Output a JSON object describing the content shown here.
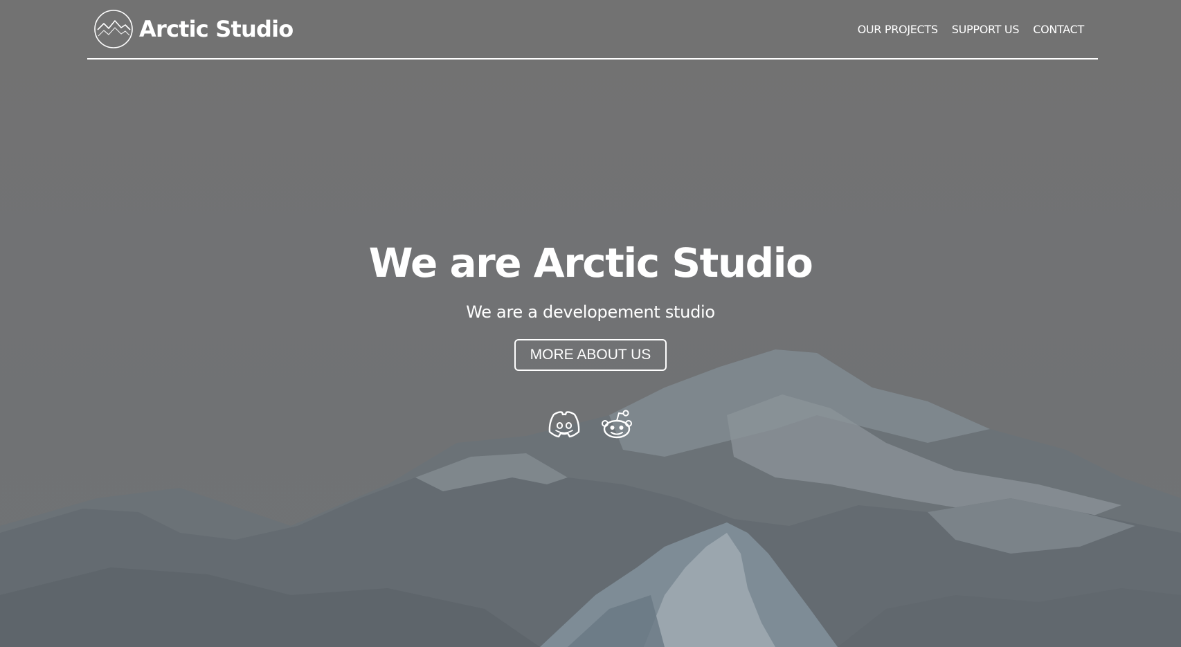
{
  "header": {
    "brand_name": "Arctic Studio",
    "logo_icon": "mountain-circle-logo",
    "nav": [
      {
        "label": "OUR PROJECTS"
      },
      {
        "label": "SUPPORT US"
      },
      {
        "label": "CONTACT"
      }
    ]
  },
  "hero": {
    "title": "We are Arctic Studio",
    "subtitle": "We are a developement studio",
    "button_label": "MORE ABOUT US"
  },
  "social": [
    {
      "icon": "discord-icon"
    },
    {
      "icon": "reddit-icon"
    }
  ],
  "colors": {
    "overlay": "#727272",
    "text": "#ffffff",
    "mountain_light": "#9aa3aa",
    "mountain_dark": "#5d646a"
  }
}
